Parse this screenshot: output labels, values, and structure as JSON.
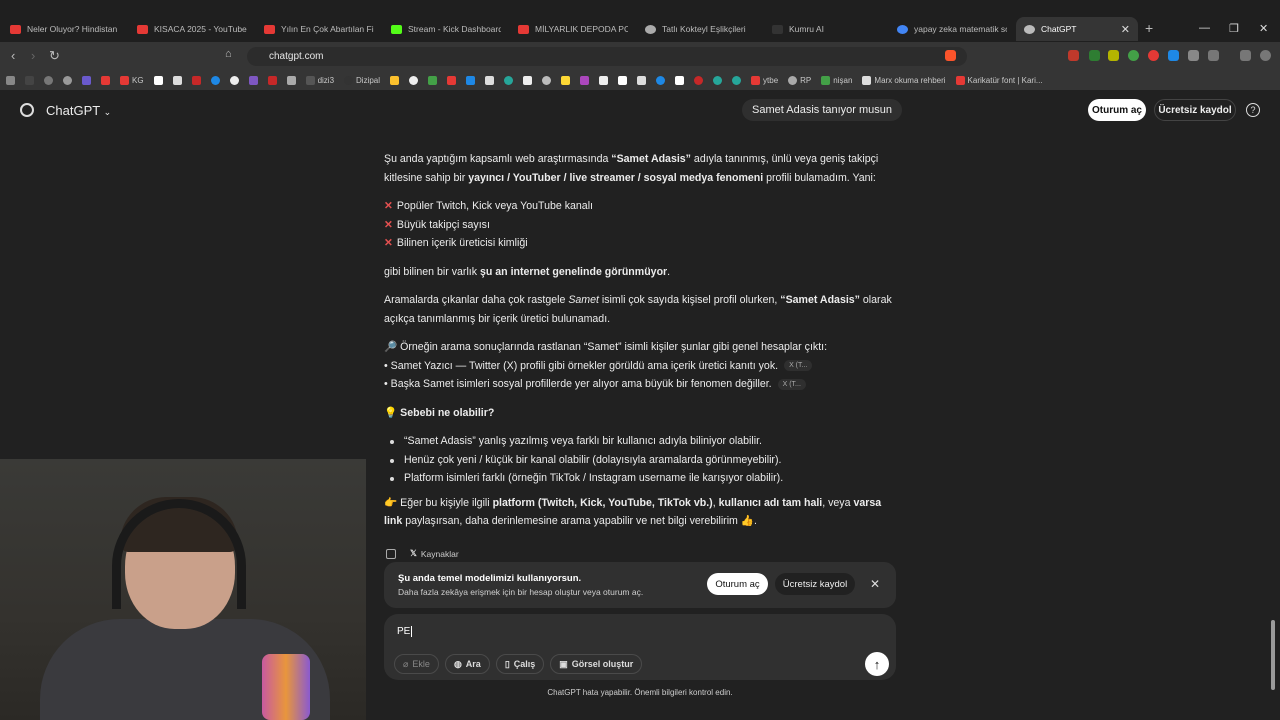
{
  "tabs": [
    {
      "label": "Neler Oluyor? Hindistan B",
      "color": "#e53935"
    },
    {
      "label": "KISACA 2025 - YouTube",
      "color": "#e53935"
    },
    {
      "label": "Yılın En Çok Abartılan Film",
      "color": "#e53935"
    },
    {
      "label": "Stream - Kick Dashboard",
      "color": "#53fc18"
    },
    {
      "label": "MİLYARLIK DEPODA PC TO",
      "color": "#e53935"
    },
    {
      "label": "Tatlı Kokteyl Eşlikçileri",
      "color": "#aaaaaa"
    },
    {
      "label": "Kumru AI",
      "color": "#333333"
    },
    {
      "label": "yapay zeka matematik sor",
      "color": "#4285f4"
    },
    {
      "label": "ChatGPT",
      "color": "#bbbbbb"
    }
  ],
  "browser": {
    "url": "chatgpt.com"
  },
  "bookmarks": [
    "KG",
    "dizi3",
    "Dizipal",
    "ytbe",
    "RP",
    "nişan",
    "Marx okuma rehberi",
    "Karikatür font | Kari..."
  ],
  "header": {
    "brand": "ChatGPT",
    "chip": "Samet Adasis tanıyor musun",
    "login": "Oturum aç",
    "signup": "Ücretsiz kaydol",
    "help": "?"
  },
  "message": {
    "p1_a": "Şu anda yaptığım kapsamlı web araştırmasında ",
    "p1_b": "“Samet Adasis”",
    "p1_c": " adıyla tanınmış, ünlü veya geniş takipçi kitlesine sahip bir ",
    "p1_d": "yayıncı / YouTuber / live streamer / sosyal medya fenomeni",
    "p1_e": " profili bulamadım. Yani:",
    "x_items": [
      "Popüler Twitch, Kick veya YouTube kanalı",
      "Büyük takipçi sayısı",
      "Bilinen içerik üreticisi kimliği"
    ],
    "p2_a": "gibi bilinen bir varlık ",
    "p2_b": "şu an internet genelinde görünmüyor",
    "p2_c": ".",
    "p3_a": "Aramalarda çıkanlar daha çok rastgele ",
    "p3_b": "Samet",
    "p3_c": " isimli çok sayıda kişisel profil olurken, ",
    "p3_d": "“Samet Adasis”",
    "p3_e": " olarak açıkça tanımlanmış bir içerik üretici bulunamadı.",
    "p4_intro": "🔎 Örneğin arama sonuçlarında rastlanan “Samet” isimli kişiler şunlar gibi genel hesaplar çıktı:",
    "p4_l1": "• Samet Yazıcı — Twitter (X) profili gibi örnekler görüldü ama içerik üretici kanıtı yok.",
    "p4_l2": "• Başka Samet isimleri sosyal profillerde yer alıyor ama büyük bir fenomen değiller.",
    "src_tag": "X (T...",
    "h_icon": "💡",
    "h_text": "Sebebi ne olabilir?",
    "reasons": [
      "“Samet Adasis” yanlış yazılmış veya farklı bir kullanıcı adıyla biliniyor olabilir.",
      "Henüz çok yeni / küçük bir kanal olabilir (dolayısıyla aramalarda görünmeyebilir).",
      "Platform isimleri farklı (örneğin TikTok / Instagram username ile karışıyor olabilir)."
    ],
    "p5_a": "👉 Eğer bu kişiyle ilgili ",
    "p5_b": "platform (Twitch, Kick, YouTube, TikTok vb.)",
    "p5_c": ", ",
    "p5_d": "kullanıcı adı tam hali",
    "p5_e": ", veya ",
    "p5_f": "varsa link",
    "p5_g": " paylaşırsan, daha derinlemesine arama yapabilir ve net bilgi verebilirim 👍.",
    "sources": "Kaynaklar"
  },
  "banner": {
    "title": "Şu anda temel modelimizi kullanıyorsun.",
    "subtitle": "Daha fazla zekâya erişmek için bir hesap oluştur veya oturum aç.",
    "login": "Oturum aç",
    "signup": "Ücretsiz kaydol"
  },
  "composer": {
    "value": "PE",
    "tools": [
      "Ekle",
      "Ara",
      "Çalış",
      "Görsel oluştur"
    ]
  },
  "footer": "ChatGPT hata yapabilir. Önemli bilgileri kontrol edin."
}
